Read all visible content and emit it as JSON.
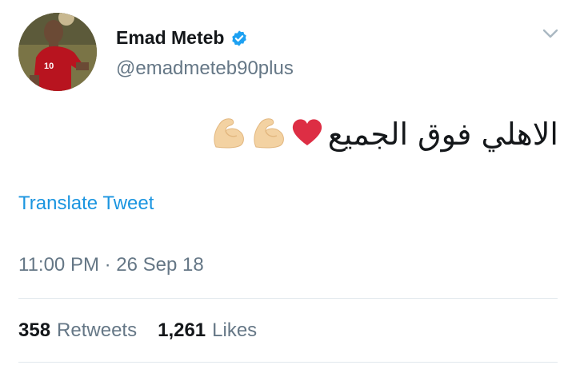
{
  "user": {
    "display_name": "Emad Meteb",
    "handle": "@emadmeteb90plus",
    "verified": true,
    "avatar_jersey_number": "10"
  },
  "tweet": {
    "text": "الاهلي فوق الجميع",
    "emojis": [
      "red-heart",
      "flexed-biceps",
      "flexed-biceps"
    ]
  },
  "translate_label": "Translate Tweet",
  "timestamp": "11:00 PM · 26 Sep 18",
  "stats": {
    "retweets_count": "358",
    "retweets_label": "Retweets",
    "likes_count": "1,261",
    "likes_label": "Likes"
  },
  "colors": {
    "link": "#1b95e0",
    "secondary_text": "#657786",
    "primary_text": "#14171a",
    "divider": "#e1e8ed",
    "verified_badge": "#1da1f2",
    "heart": "#dd2e44"
  },
  "icons": [
    "verified-badge-icon",
    "chevron-down-icon",
    "red-heart-icon",
    "flexed-biceps-icon"
  ]
}
